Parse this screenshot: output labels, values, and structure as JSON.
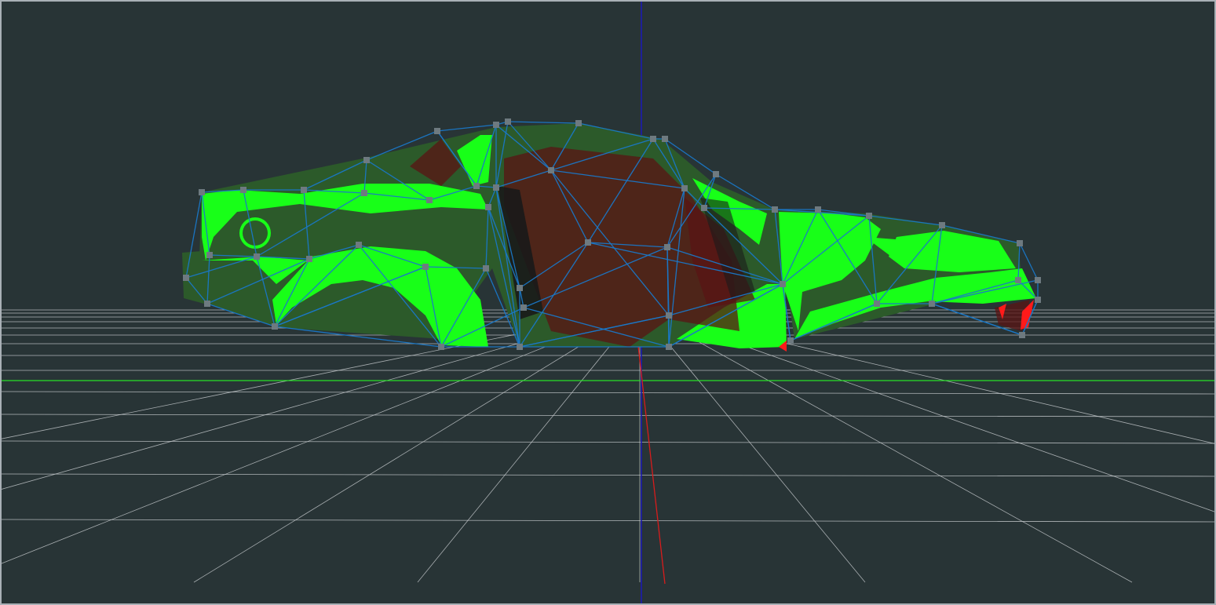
{
  "viewport": {
    "name": "3d-viewport",
    "colors": {
      "background": "#283436",
      "frame": "#a9b0b6",
      "grid_line": "#c9cdd0",
      "ground_axis": "#27e027",
      "up_axis": "#1a1ab8",
      "forward_axis": "#d81c1c",
      "body_panel": "#2c5a2a",
      "body_highlight": "#18ff18",
      "interior": "#5a1414",
      "interior_dark": "#1a1a1a",
      "beam": "#1a78c8",
      "node": "#6e7a80",
      "collision_hit": "#ff1a1a"
    },
    "icons": {
      "node": "square-node-icon"
    }
  }
}
